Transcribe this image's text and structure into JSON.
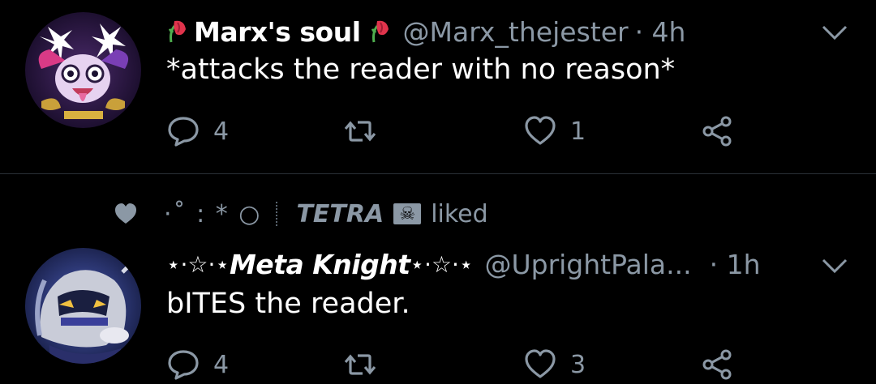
{
  "colors": {
    "background": "#000000",
    "divider": "#2a3138",
    "secondary_text": "#8b98a5",
    "primary_text": "#ffffff"
  },
  "tweets": [
    {
      "display_name": "Marx's soul",
      "name_decoration_icon": "wilted-rose-icon",
      "handle": "@Marx_thejester",
      "time": "· 4h",
      "text": "*attacks the reader with no reason*",
      "reply_count": "4",
      "retweet_count": "",
      "like_count": "1"
    },
    {
      "liked_by_prefix": "·˚ : * ○",
      "liked_by_name": "TETRA",
      "liked_by_suffix_icon": "skull-crossbones-icon",
      "liked_label": "liked",
      "name_prefix": "⋆·☆·⋆",
      "display_name": "Meta Knight",
      "name_suffix": "⋆·☆·⋆",
      "handle": "@UprightPala...",
      "time": "· 1h",
      "text": "bITES the reader.",
      "reply_count": "4",
      "retweet_count": "",
      "like_count": "3"
    }
  ],
  "icons": {
    "reply": "reply-bubble-icon",
    "retweet": "retweet-icon",
    "like": "heart-outline-icon",
    "share": "share-icon",
    "menu": "chevron-down-icon"
  }
}
